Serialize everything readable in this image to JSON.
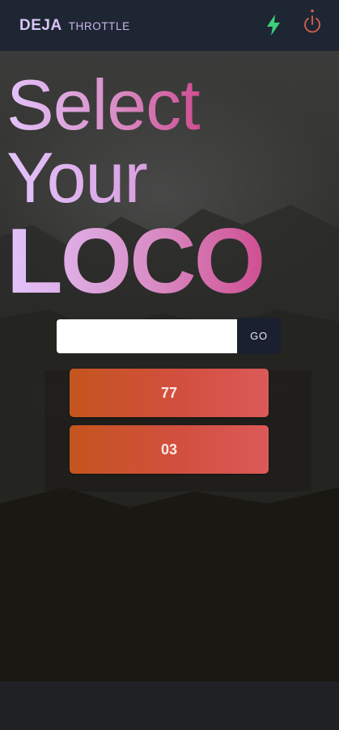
{
  "header": {
    "brand_name": "DEJA",
    "brand_subtitle": "THROTTLE",
    "icons": [
      "lightning-bolt-icon",
      "power-icon"
    ],
    "bolt_color": "#3fcf7a",
    "power_color": "#d7644c"
  },
  "hero": {
    "title_line1": "Select",
    "title_line2": "Your",
    "title_line3": "LOCO"
  },
  "search": {
    "value": "",
    "placeholder": "",
    "go_label": "GO"
  },
  "locos": [
    {
      "label": "77"
    },
    {
      "label": "03"
    }
  ],
  "colors": {
    "header_bg": "#1f2633",
    "title_gradient": [
      "#e3c3fb",
      "#cf4f92"
    ],
    "loco_button_gradient": [
      "#c4551e",
      "#db5a58"
    ],
    "go_button_bg": "#1b2030"
  }
}
